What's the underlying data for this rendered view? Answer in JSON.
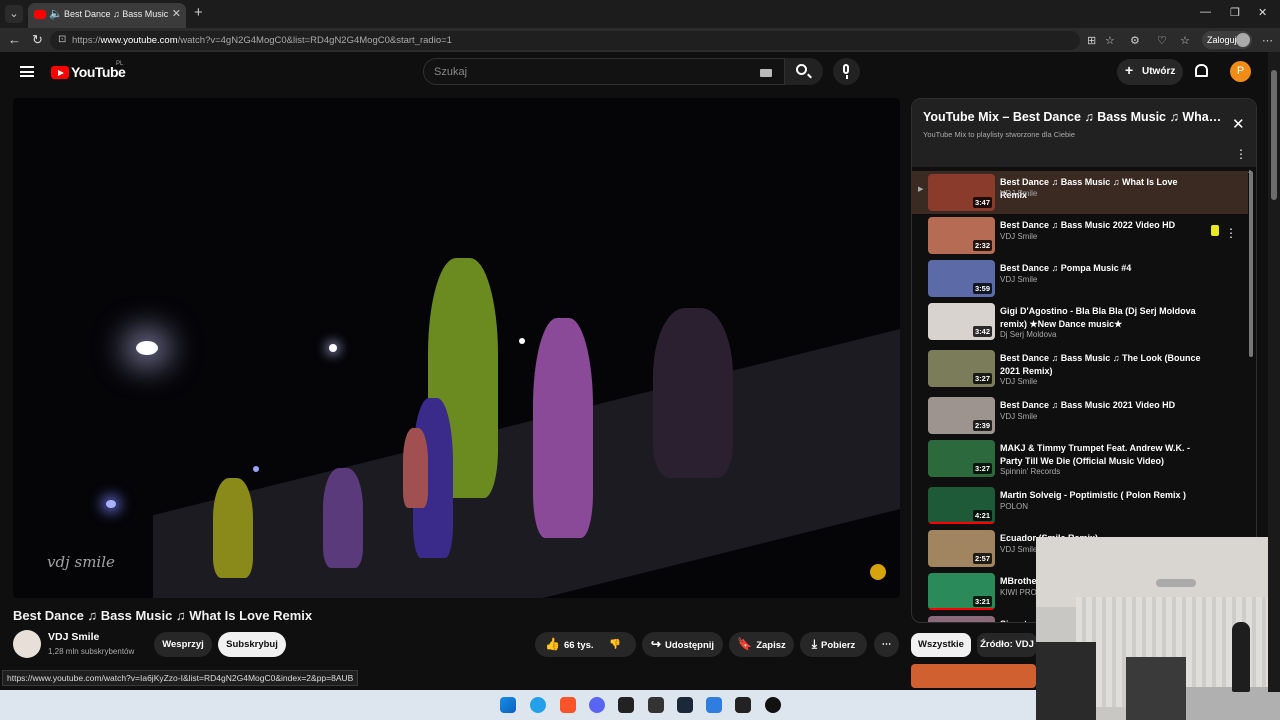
{
  "browser": {
    "tab_title": "Best Dance ♫ Bass Music ♫ What Is Love Remix",
    "url_prefix": "https://",
    "url_domain": "www.youtube.com",
    "url_rest": "/watch?v=4gN2G4MogC0&list=RD4gN2G4MogC0&start_radio=1",
    "login_label": "Zaloguj",
    "status_url": "https://www.youtube.com/watch?v=Ia6jKyZzo-I&list=RD4gN2G4MogC0&index=2&pp=8AUB"
  },
  "header": {
    "logo_text": "YouTube",
    "country_code": "PL",
    "search_placeholder": "Szukaj",
    "create_label": "Utwórz",
    "avatar_letter": "P"
  },
  "video": {
    "watermark": "vdj smile",
    "title": "Best Dance ♫ Bass Music ♫ What Is Love Remix",
    "channel": "VDJ Smile",
    "subscribers": "1,28 mln subskrybentów",
    "support_label": "Wesprzyj",
    "subscribe_label": "Subskrybuj",
    "likes": "66 tys.",
    "share_label": "Udostępnij",
    "save_label": "Zapisz",
    "download_label": "Pobierz"
  },
  "playlist": {
    "title": "YouTube Mix – Best Dance ♫ Bass Music ♫ What Is Love Remix",
    "subtitle": "YouTube Mix to playlisty stworzone dla Ciebie",
    "items": [
      {
        "title": "Best Dance ♫ Bass Music ♫ What Is Love Remix",
        "channel": "VDJ Smile",
        "duration": "3:47",
        "color": "#8a3b2c"
      },
      {
        "title": "Best Dance ♫ Bass Music 2022 Video HD",
        "channel": "VDJ Smile",
        "duration": "2:32",
        "color": "#b56b54"
      },
      {
        "title": "Best Dance ♫ Pompa Music #4",
        "channel": "VDJ Smile",
        "duration": "3:59",
        "color": "#5c6aa8"
      },
      {
        "title": "Gigi D'Agostino - Bla Bla Bla (Dj Serj Moldova remix) ★New Dance music★",
        "channel": "Dj Serj Moldova",
        "duration": "3:42",
        "color": "#d9d3cf"
      },
      {
        "title": "Best Dance ♫ Bass Music ♫ The Look (Bounce 2021 Remix)",
        "channel": "VDJ Smile",
        "duration": "3:27",
        "color": "#7a7c5a"
      },
      {
        "title": "Best Dance ♫ Bass Music 2021 Video HD",
        "channel": "VDJ Smile",
        "duration": "2:39",
        "color": "#9d9490"
      },
      {
        "title": "MAKJ & Timmy Trumpet Feat. Andrew W.K. - Party Till We Die (Official Music Video)",
        "channel": "Spinnin' Records",
        "duration": "3:27",
        "color": "#2c6a3e"
      },
      {
        "title": "Martin Solveig - Poptimistic ( Polon Remix )",
        "channel": "POLON",
        "duration": "4:21",
        "color": "#1e5a38"
      },
      {
        "title": "Ecuador (Smile Remix)",
        "channel": "VDJ Smile",
        "duration": "2:57",
        "color": "#a08560"
      },
      {
        "title": "MBrother",
        "channel": "KIWI PRO",
        "duration": "3:21",
        "color": "#2a8a5a"
      },
      {
        "title": "Sinectra",
        "channel": "",
        "duration": "",
        "color": "#8a6a78"
      }
    ]
  },
  "chips": {
    "all": "Wszystkie",
    "source": "Źródło: VDJ"
  },
  "colors": {
    "accent_red": "#ff0000",
    "avatar_orange": "#f28c18",
    "taskbar_bg": "#dde6ef"
  }
}
